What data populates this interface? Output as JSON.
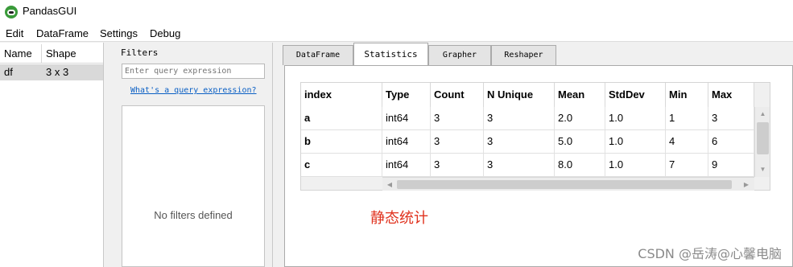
{
  "app": {
    "title": "PandasGUI"
  },
  "menu": [
    "Edit",
    "DataFrame",
    "Settings",
    "Debug"
  ],
  "df_panel": {
    "headers": [
      "Name",
      "Shape"
    ],
    "rows": [
      {
        "name": "df",
        "shape": "3 x 3"
      }
    ]
  },
  "filters": {
    "label": "Filters",
    "placeholder": "Enter query expression",
    "help_link": "What's a query expression?",
    "empty_text": "No filters defined"
  },
  "tabs": [
    "DataFrame",
    "Statistics",
    "Grapher",
    "Reshaper"
  ],
  "active_tab": "Statistics",
  "stats": {
    "columns": [
      "index",
      "Type",
      "Count",
      "N Unique",
      "Mean",
      "StdDev",
      "Min",
      "Max"
    ],
    "rows": [
      [
        "a",
        "int64",
        "3",
        "3",
        "2.0",
        "1.0",
        "1",
        "3"
      ],
      [
        "b",
        "int64",
        "3",
        "3",
        "5.0",
        "1.0",
        "4",
        "6"
      ],
      [
        "c",
        "int64",
        "3",
        "3",
        "8.0",
        "1.0",
        "7",
        "9"
      ]
    ]
  },
  "annotation": "静态统计",
  "watermark": "CSDN @岳涛@心馨电脑",
  "colors": {
    "annotation": "#e0321e",
    "link": "#0a5fc4",
    "selected_row": "#d9d9d9"
  }
}
